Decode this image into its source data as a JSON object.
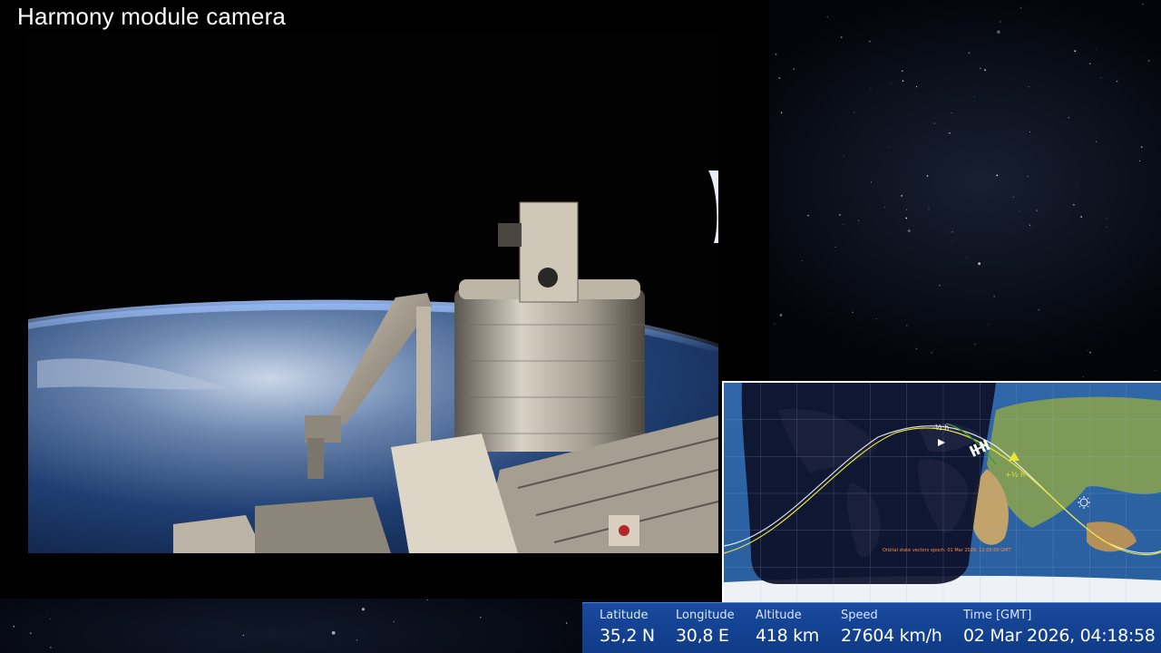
{
  "camera": {
    "title": "Harmony module camera"
  },
  "map": {
    "epoch_note": "Orbital state vectors epoch: 01 Mar 2026, 12:00:00 GMT",
    "marker_plus_half": "+½ h",
    "marker_minus_half": "-½ h",
    "track_color_past": "#ffffff",
    "track_color_future": "#e8e23c",
    "sun_icon": "sun-icon",
    "station_icon": "iss-icon"
  },
  "telemetry": {
    "latitude_label": "Latitude",
    "latitude_value": "35,2 N",
    "longitude_label": "Longitude",
    "longitude_value": "30,8 E",
    "altitude_label": "Altitude",
    "altitude_value": "418 km",
    "speed_label": "Speed",
    "speed_value": "27604 km/h",
    "time_label": "Time [GMT]",
    "time_value": "02 Mar 2026, 04:18:58",
    "bar_color": "#1a4a9e"
  }
}
